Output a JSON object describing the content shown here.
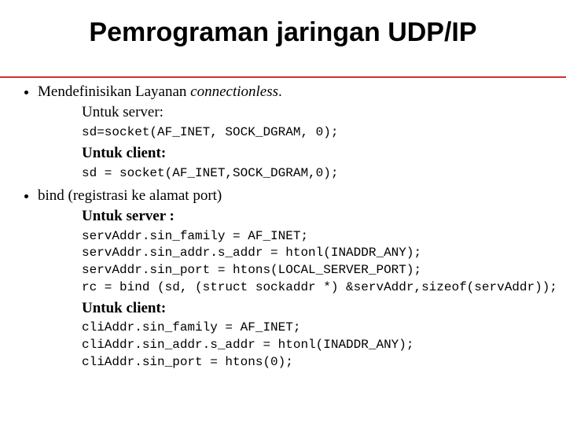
{
  "title": "Pemrograman jaringan UDP/IP",
  "bullets": {
    "b1": {
      "text_a": "Mendefinisikan Layanan ",
      "text_b": "connectionless",
      "text_c": ".",
      "server_label": "Untuk server:",
      "server_code": "sd=socket(AF_INET, SOCK_DGRAM, 0);",
      "client_label": "Untuk client:",
      "client_code": "sd = socket(AF_INET,SOCK_DGRAM,0);"
    },
    "b2": {
      "text": "bind (registrasi ke alamat port)",
      "server_label": "Untuk server :",
      "server_code": "servAddr.sin_family = AF_INET;\nservAddr.sin_addr.s_addr = htonl(INADDR_ANY);\nservAddr.sin_port = htons(LOCAL_SERVER_PORT);\nrc = bind (sd, (struct sockaddr *) &servAddr,sizeof(servAddr));",
      "client_label": "Untuk client:",
      "client_code": "cliAddr.sin_family = AF_INET;\ncliAddr.sin_addr.s_addr = htonl(INADDR_ANY);\ncliAddr.sin_port = htons(0);"
    }
  }
}
